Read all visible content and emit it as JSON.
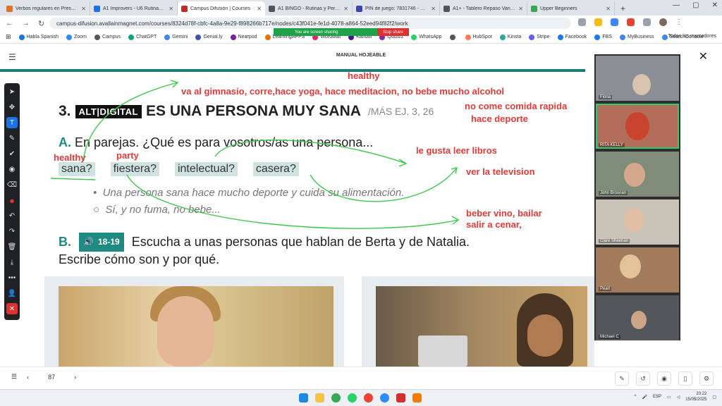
{
  "browser": {
    "tabs": [
      {
        "title": "Verbos regulares en Presente -",
        "color": "#e8711c",
        "active": false
      },
      {
        "title": "A1 Improvers - U6 Rutinas y Ca",
        "color": "#1a73e8",
        "active": false
      },
      {
        "title": "Campus Difusión | Courses",
        "color": "#c62828",
        "active": true
      },
      {
        "title": "A1 BINGO - Rutinas y Personal",
        "color": "#555555",
        "active": false
      },
      {
        "title": "PIN de juego: 7831746 - Esper",
        "color": "#3949ab",
        "active": false
      },
      {
        "title": "A1+ - Tablero Repaso Variado",
        "color": "#555555",
        "active": false
      },
      {
        "title": "Upper Beginners",
        "color": "#34a853",
        "active": false
      }
    ],
    "url": "campus-difusion.avallainmagnet.com/courses/8324d78f-cbfc-4a8a-9e29-f898266b717e/nodes/c43f041e-fe1d-4078-a864-52eed94f82f2/work",
    "bookmarks": [
      "Habla Spanish",
      "Zoom",
      "Campus",
      "ChatGPT",
      "Gemini",
      "Genial.ly",
      "Nearpod",
      "LearningAPPS",
      "Wordwall",
      "Kahoot",
      "Quizizz",
      "WhatsApp",
      "",
      "HubSpot",
      "Kinsta",
      "Stripe",
      "Facebook",
      "FBS",
      "MyBusiness",
      "SearchConsole"
    ],
    "all_bookmarks": "Todos los marcadores",
    "sharing_text": "You are screen sharing",
    "stop_share": "Stop share"
  },
  "app": {
    "title": "MANUAL HOJEABLE"
  },
  "exercise": {
    "number": "3.",
    "badge": "ALT|DIGITAL",
    "title": "ES UNA PERSONA MUY SANA",
    "ref": "/MÁS EJ. 3, 26",
    "a_letter": "A.",
    "a_text": "En parejas. ¿Qué es para vosotros/as una persona...",
    "pills": [
      "sana?",
      "fiestera?",
      "intelectual?",
      "casera?"
    ],
    "bullet1": "Una persona sana hace mucho deporte y cuida su alimentación.",
    "bullet2": "Sí, y no fuma, no bebe...",
    "b_letter": "B.",
    "audio_label": "18-19",
    "b_text_1": "Escucha a unas personas que hablan de Berta y de Natalia.",
    "b_text_2": "Escribe cómo son y por qué."
  },
  "annotations": {
    "healthy_top": "healthy",
    "line1": "va al gimnasio, corre,hace yoga,  hace meditacion, no bebe mucho alcohol",
    "line2a": "no come comida rapida",
    "line2b": "hace deporte",
    "healthy_left": "healthy",
    "party": "party",
    "intellectual": "le gusta leer libros",
    "casera": "ver la television",
    "fiestera1": "beber vino, bailar",
    "fiestera2": "salir a cenar,",
    "color": "#e53935",
    "arrow_color": "#3cc94a"
  },
  "participants": [
    "Fiona",
    "RITA KELLY",
    "John Brosnan",
    "Clare Sheehan",
    "Pearl",
    "Michael C"
  ],
  "pager": {
    "page": "87"
  },
  "taskbar": {
    "lang": "ESP",
    "time": "20:22",
    "date": "15/05/2025"
  }
}
